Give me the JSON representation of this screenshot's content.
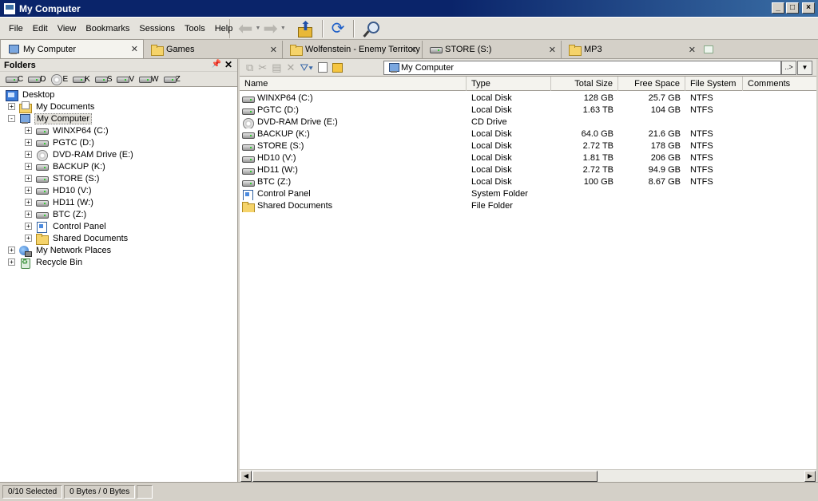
{
  "window": {
    "title": "My Computer"
  },
  "menu": [
    "File",
    "Edit",
    "View",
    "Bookmarks",
    "Sessions",
    "Tools",
    "Help"
  ],
  "tabs": [
    {
      "label": "My Computer",
      "icon": "computer-icon",
      "active": true
    },
    {
      "label": "Games",
      "icon": "folder-icon"
    },
    {
      "label": "Wolfenstein - Enemy Territory",
      "icon": "folder-icon"
    },
    {
      "label": "STORE (S:)",
      "icon": "drive-icon"
    },
    {
      "label": "MP3",
      "icon": "folder-icon"
    }
  ],
  "folders_pane": {
    "title": "Folders",
    "drive_buttons": [
      "C",
      "D",
      "E",
      "K",
      "S",
      "V",
      "W",
      "Z"
    ],
    "tree": [
      {
        "label": "Desktop",
        "icon": "desktop",
        "level": 0
      },
      {
        "label": "My Documents",
        "icon": "docs",
        "level": 1,
        "expander": "+"
      },
      {
        "label": "My Computer",
        "icon": "computer",
        "level": 1,
        "expander": "-",
        "selected": true
      },
      {
        "label": "WINXP64 (C:)",
        "icon": "drive",
        "level": 2,
        "expander": "+"
      },
      {
        "label": "PGTC (D:)",
        "icon": "drive",
        "level": 2,
        "expander": "+"
      },
      {
        "label": "DVD-RAM Drive (E:)",
        "icon": "cd",
        "level": 2,
        "expander": "+"
      },
      {
        "label": "BACKUP (K:)",
        "icon": "drive",
        "level": 2,
        "expander": "+"
      },
      {
        "label": "STORE (S:)",
        "icon": "drive",
        "level": 2,
        "expander": "+"
      },
      {
        "label": "HD10 (V:)",
        "icon": "drive",
        "level": 2,
        "expander": "+"
      },
      {
        "label": "HD11 (W:)",
        "icon": "drive",
        "level": 2,
        "expander": "+"
      },
      {
        "label": "BTC (Z:)",
        "icon": "drive",
        "level": 2,
        "expander": "+"
      },
      {
        "label": "Control Panel",
        "icon": "cpanel",
        "level": 2,
        "expander": "+"
      },
      {
        "label": "Shared Documents",
        "icon": "folder",
        "level": 2,
        "expander": "+"
      },
      {
        "label": "My Network Places",
        "icon": "network",
        "level": 1,
        "expander": "+"
      },
      {
        "label": "Recycle Bin",
        "icon": "recycle",
        "level": 1,
        "expander": "+"
      }
    ]
  },
  "address": {
    "value": "My Computer",
    "go_label": "..>"
  },
  "list": {
    "columns": [
      "Name",
      "Type",
      "Total Size",
      "Free Space",
      "File System",
      "Comments"
    ],
    "rows": [
      {
        "name": "WINXP64 (C:)",
        "icon": "drive",
        "type": "Local Disk",
        "total": "128 GB",
        "free": "25.7 GB",
        "fs": "NTFS"
      },
      {
        "name": "PGTC (D:)",
        "icon": "drive",
        "type": "Local Disk",
        "total": "1.63 TB",
        "free": "104 GB",
        "fs": "NTFS"
      },
      {
        "name": "DVD-RAM Drive (E:)",
        "icon": "cd",
        "type": "CD Drive",
        "total": "",
        "free": "",
        "fs": ""
      },
      {
        "name": "BACKUP (K:)",
        "icon": "drive",
        "type": "Local Disk",
        "total": "64.0 GB",
        "free": "21.6 GB",
        "fs": "NTFS"
      },
      {
        "name": "STORE (S:)",
        "icon": "drive",
        "type": "Local Disk",
        "total": "2.72 TB",
        "free": "178 GB",
        "fs": "NTFS"
      },
      {
        "name": "HD10 (V:)",
        "icon": "drive",
        "type": "Local Disk",
        "total": "1.81 TB",
        "free": "206 GB",
        "fs": "NTFS"
      },
      {
        "name": "HD11 (W:)",
        "icon": "drive",
        "type": "Local Disk",
        "total": "2.72 TB",
        "free": "94.9 GB",
        "fs": "NTFS"
      },
      {
        "name": "BTC (Z:)",
        "icon": "drive",
        "type": "Local Disk",
        "total": "100 GB",
        "free": "8.67 GB",
        "fs": "NTFS"
      },
      {
        "name": "Control Panel",
        "icon": "cpanel",
        "type": "System Folder",
        "total": "",
        "free": "",
        "fs": ""
      },
      {
        "name": "Shared Documents",
        "icon": "folder",
        "type": "File Folder",
        "total": "",
        "free": "",
        "fs": ""
      }
    ]
  },
  "status": {
    "selected": "0/10 Selected",
    "bytes": "0 Bytes / 0 Bytes"
  }
}
